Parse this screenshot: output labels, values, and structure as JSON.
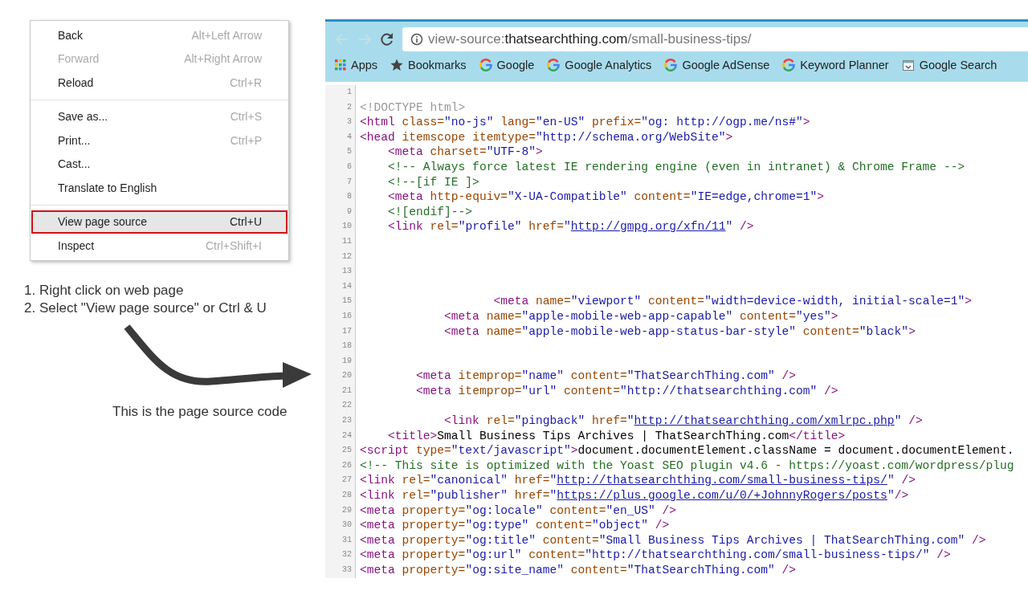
{
  "context_menu": {
    "groups": [
      [
        {
          "label": "Back",
          "shortcut": "Alt+Left Arrow",
          "disabled": false,
          "selected": false
        },
        {
          "label": "Forward",
          "shortcut": "Alt+Right Arrow",
          "disabled": true,
          "selected": false
        },
        {
          "label": "Reload",
          "shortcut": "Ctrl+R",
          "disabled": false,
          "selected": false
        }
      ],
      [
        {
          "label": "Save as...",
          "shortcut": "Ctrl+S",
          "disabled": false,
          "selected": false
        },
        {
          "label": "Print...",
          "shortcut": "Ctrl+P",
          "disabled": false,
          "selected": false
        },
        {
          "label": "Cast...",
          "disabled": false,
          "selected": false
        },
        {
          "label": "Translate to English",
          "disabled": false,
          "selected": false
        }
      ],
      [
        {
          "label": "View page source",
          "shortcut": "Ctrl+U",
          "disabled": false,
          "selected": true
        },
        {
          "label": "Inspect",
          "shortcut": "Ctrl+Shift+I",
          "disabled": false,
          "selected": false
        }
      ]
    ]
  },
  "instructions": [
    "1. Right click on web page",
    "2. Select \"View page source\" or Ctrl & U"
  ],
  "caption": "This is the page source code",
  "browser": {
    "address": [
      {
        "kind": "scheme",
        "text": "view-source:"
      },
      {
        "kind": "host",
        "text": "thatsearchthing.com"
      },
      {
        "kind": "path",
        "text": "/small-business-tips/"
      }
    ],
    "bookmarks": [
      {
        "kind": "apps",
        "label": "Apps"
      },
      {
        "kind": "star",
        "label": "Bookmarks"
      },
      {
        "kind": "g",
        "label": "Google"
      },
      {
        "kind": "g",
        "label": "Google Analytics"
      },
      {
        "kind": "g",
        "label": "Google AdSense"
      },
      {
        "kind": "g",
        "label": "Keyword Planner"
      },
      {
        "kind": "page",
        "label": "Google Search"
      }
    ],
    "source_lines": [
      {
        "number": "1"
      },
      {
        "number": "2",
        "tokens": [
          {
            "kind": "doctype",
            "text": "<!DOCTYPE html>"
          }
        ]
      },
      {
        "number": "3",
        "tokens": [
          {
            "kind": "tag",
            "text": "<html"
          },
          {
            "kind": "attr",
            "text": " class="
          },
          {
            "kind": "value",
            "text": "\"no-js\""
          },
          {
            "kind": "attr",
            "text": " lang="
          },
          {
            "kind": "value",
            "text": "\"en-US\""
          },
          {
            "kind": "attr",
            "text": " prefix="
          },
          {
            "kind": "value",
            "text": "\"og: http://ogp.me/ns#\""
          },
          {
            "kind": "tag",
            "text": ">"
          }
        ]
      },
      {
        "number": "4",
        "tokens": [
          {
            "kind": "tag",
            "text": "<head"
          },
          {
            "kind": "attr",
            "text": " itemscope itemtype="
          },
          {
            "kind": "value",
            "text": "\"http://schema.org/WebSite\""
          },
          {
            "kind": "tag",
            "text": ">"
          }
        ]
      },
      {
        "number": "5",
        "tokens": [
          {
            "kind": "tag",
            "text": "    <meta"
          },
          {
            "kind": "attr",
            "text": " charset="
          },
          {
            "kind": "value",
            "text": "\"UTF-8\""
          },
          {
            "kind": "tag",
            "text": ">"
          }
        ]
      },
      {
        "number": "6",
        "tokens": [
          {
            "kind": "comment",
            "text": "    <!-- Always force latest IE rendering engine (even in intranet) & Chrome Frame -->"
          }
        ]
      },
      {
        "number": "7",
        "tokens": [
          {
            "kind": "comment",
            "text": "    <!--[if IE ]>"
          }
        ]
      },
      {
        "number": "8",
        "tokens": [
          {
            "kind": "tag",
            "text": "    <meta"
          },
          {
            "kind": "attr",
            "text": " http-equiv="
          },
          {
            "kind": "value",
            "text": "\"X-UA-Compatible\""
          },
          {
            "kind": "attr",
            "text": " content="
          },
          {
            "kind": "value",
            "text": "\"IE=edge,chrome=1\""
          },
          {
            "kind": "tag",
            "text": ">"
          }
        ]
      },
      {
        "number": "9",
        "tokens": [
          {
            "kind": "comment",
            "text": "    <![endif]-->"
          }
        ]
      },
      {
        "number": "10",
        "tokens": [
          {
            "kind": "tag",
            "text": "    <link"
          },
          {
            "kind": "attr",
            "text": " rel="
          },
          {
            "kind": "value",
            "text": "\"profile\""
          },
          {
            "kind": "attr",
            "text": " href="
          },
          {
            "kind": "value",
            "text": "\""
          },
          {
            "kind": "link",
            "text": "http://gmpg.org/xfn/11"
          },
          {
            "kind": "value",
            "text": "\""
          },
          {
            "kind": "tag",
            "text": " />"
          }
        ]
      },
      {
        "number": "11"
      },
      {
        "number": "12"
      },
      {
        "number": "13"
      },
      {
        "number": "14"
      },
      {
        "number": "15",
        "tokens": [
          {
            "kind": "tag",
            "text": "                   <meta"
          },
          {
            "kind": "attr",
            "text": " name="
          },
          {
            "kind": "value",
            "text": "\"viewport\""
          },
          {
            "kind": "attr",
            "text": " content="
          },
          {
            "kind": "value",
            "text": "\"width=device-width, initial-scale=1\""
          },
          {
            "kind": "tag",
            "text": ">"
          }
        ]
      },
      {
        "number": "16",
        "tokens": [
          {
            "kind": "tag",
            "text": "            <meta"
          },
          {
            "kind": "attr",
            "text": " name="
          },
          {
            "kind": "value",
            "text": "\"apple-mobile-web-app-capable\""
          },
          {
            "kind": "attr",
            "text": " content="
          },
          {
            "kind": "value",
            "text": "\"yes\""
          },
          {
            "kind": "tag",
            "text": ">"
          }
        ]
      },
      {
        "number": "17",
        "tokens": [
          {
            "kind": "tag",
            "text": "            <meta"
          },
          {
            "kind": "attr",
            "text": " name="
          },
          {
            "kind": "value",
            "text": "\"apple-mobile-web-app-status-bar-style\""
          },
          {
            "kind": "attr",
            "text": " content="
          },
          {
            "kind": "value",
            "text": "\"black\""
          },
          {
            "kind": "tag",
            "text": ">"
          }
        ]
      },
      {
        "number": "18"
      },
      {
        "number": "19"
      },
      {
        "number": "20",
        "tokens": [
          {
            "kind": "tag",
            "text": "        <meta"
          },
          {
            "kind": "attr",
            "text": " itemprop="
          },
          {
            "kind": "value",
            "text": "\"name\""
          },
          {
            "kind": "attr",
            "text": " content="
          },
          {
            "kind": "value",
            "text": "\"ThatSearchThing.com\""
          },
          {
            "kind": "tag",
            "text": " />"
          }
        ]
      },
      {
        "number": "21",
        "tokens": [
          {
            "kind": "tag",
            "text": "        <meta"
          },
          {
            "kind": "attr",
            "text": " itemprop="
          },
          {
            "kind": "value",
            "text": "\"url\""
          },
          {
            "kind": "attr",
            "text": " content="
          },
          {
            "kind": "value",
            "text": "\"http://thatsearchthing.com\""
          },
          {
            "kind": "tag",
            "text": " />"
          }
        ]
      },
      {
        "number": "22"
      },
      {
        "number": "23",
        "tokens": [
          {
            "kind": "tag",
            "text": "            <link"
          },
          {
            "kind": "attr",
            "text": " rel="
          },
          {
            "kind": "value",
            "text": "\"pingback\""
          },
          {
            "kind": "attr",
            "text": " href="
          },
          {
            "kind": "value",
            "text": "\""
          },
          {
            "kind": "link",
            "text": "http://thatsearchthing.com/xmlrpc.php"
          },
          {
            "kind": "value",
            "text": "\""
          },
          {
            "kind": "tag",
            "text": " />"
          }
        ]
      },
      {
        "number": "24",
        "tokens": [
          {
            "kind": "tag",
            "text": "    <title>"
          },
          {
            "kind": "text",
            "text": "Small Business Tips Archives | ThatSearchThing.com"
          },
          {
            "kind": "tag",
            "text": "</title>"
          }
        ]
      },
      {
        "number": "25",
        "tokens": [
          {
            "kind": "tag",
            "text": "<script"
          },
          {
            "kind": "attr",
            "text": " type="
          },
          {
            "kind": "value",
            "text": "\"text/javascript\""
          },
          {
            "kind": "tag",
            "text": ">"
          },
          {
            "kind": "text",
            "text": "document.documentElement.className = document.documentElement."
          }
        ]
      },
      {
        "number": "26",
        "tokens": [
          {
            "kind": "comment",
            "text": "<!-- This site is optimized with the Yoast SEO plugin v4.6 - https://yoast.com/wordpress/plug"
          }
        ]
      },
      {
        "number": "27",
        "tokens": [
          {
            "kind": "tag",
            "text": "<link"
          },
          {
            "kind": "attr",
            "text": " rel="
          },
          {
            "kind": "value",
            "text": "\"canonical\""
          },
          {
            "kind": "attr",
            "text": " href="
          },
          {
            "kind": "value",
            "text": "\""
          },
          {
            "kind": "link",
            "text": "http://thatsearchthing.com/small-business-tips/"
          },
          {
            "kind": "value",
            "text": "\""
          },
          {
            "kind": "tag",
            "text": " />"
          }
        ]
      },
      {
        "number": "28",
        "tokens": [
          {
            "kind": "tag",
            "text": "<link"
          },
          {
            "kind": "attr",
            "text": " rel="
          },
          {
            "kind": "value",
            "text": "\"publisher\""
          },
          {
            "kind": "attr",
            "text": " href="
          },
          {
            "kind": "value",
            "text": "\""
          },
          {
            "kind": "link",
            "text": "https://plus.google.com/u/0/+JohnnyRogers/posts"
          },
          {
            "kind": "value",
            "text": "\""
          },
          {
            "kind": "tag",
            "text": "/>"
          }
        ]
      },
      {
        "number": "29",
        "tokens": [
          {
            "kind": "tag",
            "text": "<meta"
          },
          {
            "kind": "attr",
            "text": " property="
          },
          {
            "kind": "value",
            "text": "\"og:locale\""
          },
          {
            "kind": "attr",
            "text": " content="
          },
          {
            "kind": "value",
            "text": "\"en_US\""
          },
          {
            "kind": "tag",
            "text": " />"
          }
        ]
      },
      {
        "number": "30",
        "tokens": [
          {
            "kind": "tag",
            "text": "<meta"
          },
          {
            "kind": "attr",
            "text": " property="
          },
          {
            "kind": "value",
            "text": "\"og:type\""
          },
          {
            "kind": "attr",
            "text": " content="
          },
          {
            "kind": "value",
            "text": "\"object\""
          },
          {
            "kind": "tag",
            "text": " />"
          }
        ]
      },
      {
        "number": "31",
        "tokens": [
          {
            "kind": "tag",
            "text": "<meta"
          },
          {
            "kind": "attr",
            "text": " property="
          },
          {
            "kind": "value",
            "text": "\"og:title\""
          },
          {
            "kind": "attr",
            "text": " content="
          },
          {
            "kind": "value",
            "text": "\"Small Business Tips Archives | ThatSearchThing.com\""
          },
          {
            "kind": "tag",
            "text": " />"
          }
        ]
      },
      {
        "number": "32",
        "tokens": [
          {
            "kind": "tag",
            "text": "<meta"
          },
          {
            "kind": "attr",
            "text": " property="
          },
          {
            "kind": "value",
            "text": "\"og:url\""
          },
          {
            "kind": "attr",
            "text": " content="
          },
          {
            "kind": "value",
            "text": "\"http://thatsearchthing.com/small-business-tips/\""
          },
          {
            "kind": "tag",
            "text": " />"
          }
        ]
      },
      {
        "number": "33",
        "tokens": [
          {
            "kind": "tag",
            "text": "<meta"
          },
          {
            "kind": "attr",
            "text": " property="
          },
          {
            "kind": "value",
            "text": "\"og:site_name\""
          },
          {
            "kind": "attr",
            "text": " content="
          },
          {
            "kind": "value",
            "text": "\"ThatSearchThing.com\""
          },
          {
            "kind": "tag",
            "text": " />"
          }
        ]
      }
    ]
  }
}
